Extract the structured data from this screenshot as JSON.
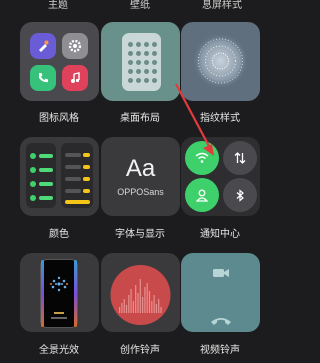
{
  "top_labels": [
    "主题",
    "壁纸",
    "息屏样式"
  ],
  "tiles": [
    {
      "label": "图标风格"
    },
    {
      "label": "桌面布局"
    },
    {
      "label": "指纹样式"
    },
    {
      "label": "颜色"
    },
    {
      "label": "字体与显示"
    },
    {
      "label": "通知中心"
    },
    {
      "label": "全景光效"
    },
    {
      "label": "创作铃声"
    },
    {
      "label": "视频铃声"
    }
  ],
  "font_preview": {
    "glyph": "Aa",
    "font_name": "OPPOSans"
  },
  "icons": {
    "icon_style_apps": [
      "paint-brush-icon",
      "gear-icon",
      "phone-icon",
      "music-icon"
    ],
    "control_center": [
      "wifi-icon",
      "data-arrows-icon",
      "user-icon",
      "bluetooth-icon"
    ],
    "video_ringtone": [
      "video-camera-icon",
      "hang-up-icon"
    ]
  },
  "colors": {
    "background": "#1c1c1e",
    "tile_dark": "#3a3a3d",
    "accent_green": "#3ed16b",
    "desktop_teal": "#68918c",
    "fingerprint_slate": "#5f6f7e",
    "ringtone_red": "#c94a4a",
    "arrow_red": "#e23b3b"
  }
}
